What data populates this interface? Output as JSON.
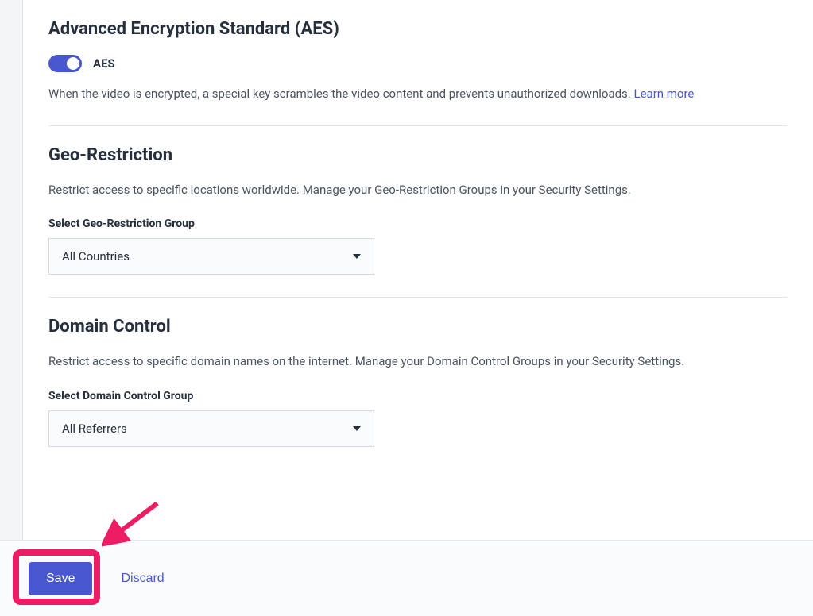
{
  "aes": {
    "title": "Advanced Encryption Standard (AES)",
    "toggle_label": "AES",
    "toggle_on": true,
    "description": "When the video is encrypted, a special key scrambles the video content and prevents unauthorized downloads.",
    "learn_more": "Learn more"
  },
  "geo": {
    "title": "Geo-Restriction",
    "description": "Restrict access to specific locations worldwide. Manage your Geo-Restriction Groups in your Security Settings.",
    "field_label": "Select Geo-Restriction Group",
    "selected": "All Countries"
  },
  "domain": {
    "title": "Domain Control",
    "description": "Restrict access to specific domain names on the internet. Manage your Domain Control Groups in your Security Settings.",
    "field_label": "Select Domain Control Group",
    "selected": "All Referrers"
  },
  "footer": {
    "save_label": "Save",
    "discard_label": "Discard"
  },
  "colors": {
    "accent": "#4857cf",
    "annotation": "#ec1d64"
  }
}
